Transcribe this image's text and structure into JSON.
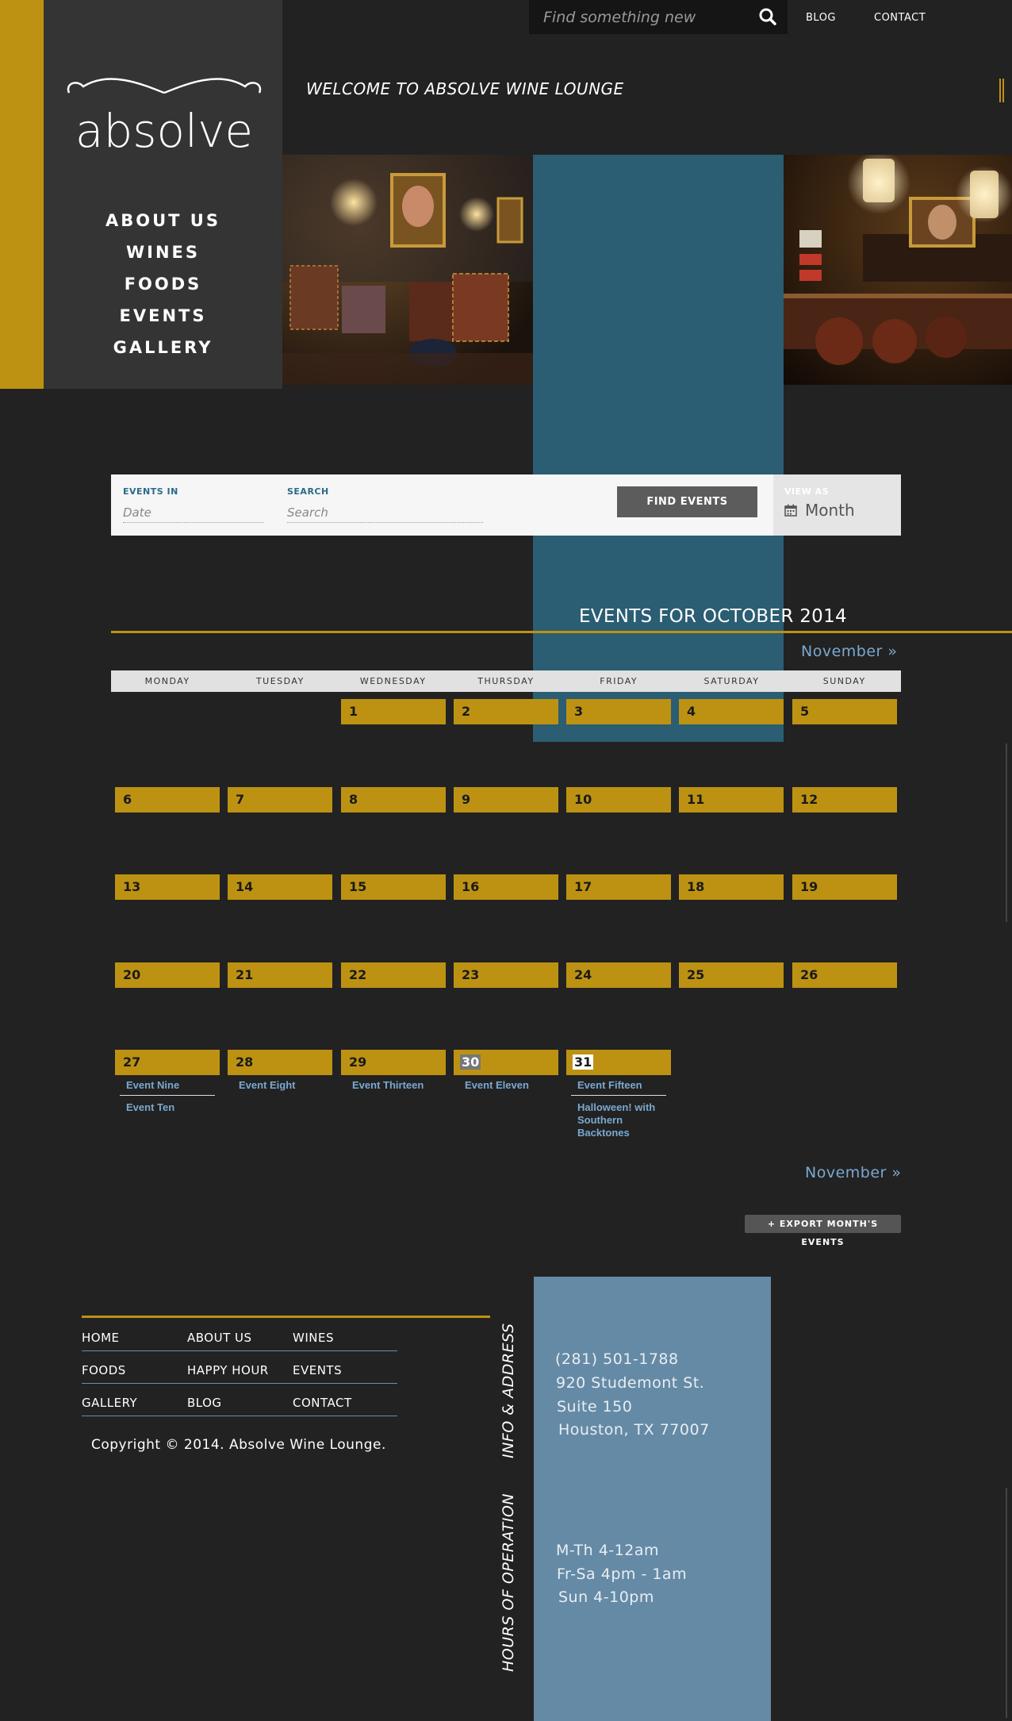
{
  "brand": {
    "logo_text": "absolve",
    "gold": "#bd9212",
    "blue": "#2b5d73",
    "info_blue": "#658aa5"
  },
  "nav_main": [
    "ABOUT US",
    "WINES",
    "FOODS",
    "EVENTS",
    "GALLERY"
  ],
  "topbar": {
    "search_placeholder": "Find something new",
    "search_icon": "search-icon",
    "links": [
      "BLOG",
      "CONTACT"
    ]
  },
  "welcome": "WELCOME TO ABSOLVE WINE LOUNGE",
  "filter": {
    "events_in_label": "EVENTS IN",
    "date_placeholder": "Date",
    "search_label": "SEARCH",
    "search_placeholder": "Search",
    "find_button": "FIND EVENTS",
    "view_as_label": "VIEW AS",
    "view_as_value": "Month",
    "view_icon": "calendar-icon"
  },
  "calendar": {
    "title": "EVENTS FOR OCTOBER 2014",
    "next_label": "November »",
    "weekdays": [
      "MONDAY",
      "TUESDAY",
      "WEDNESDAY",
      "THURSDAY",
      "FRIDAY",
      "SATURDAY",
      "SUNDAY"
    ],
    "first_weekday_index": 2,
    "days_in_month": 31,
    "highlight_white": 31,
    "highlight_grey": 30,
    "events": [
      {
        "day": 27,
        "titles": [
          "Event Nine",
          "Event Ten"
        ]
      },
      {
        "day": 28,
        "titles": [
          "Event Eight"
        ]
      },
      {
        "day": 29,
        "titles": [
          "Event Thirteen"
        ]
      },
      {
        "day": 30,
        "titles": [
          "Event Eleven"
        ]
      },
      {
        "day": 31,
        "titles": [
          "Event Fifteen",
          "Halloween! with Southern Backtones"
        ]
      }
    ],
    "export_label": "+ EXPORT MONTH'S EVENTS"
  },
  "footer": {
    "links": [
      "HOME",
      "ABOUT US",
      "WINES",
      "FOODS",
      "HAPPY HOUR",
      "EVENTS",
      "GALLERY",
      "BLOG",
      "CONTACT"
    ],
    "copyright": "Copyright © 2014. Absolve Wine Lounge.",
    "info_title": "INFO & ADDRESS",
    "hours_title": "HOURS OF OPERATION",
    "phone": "(281) 501-1788",
    "address": [
      "920 Studemont St.",
      "Suite 150",
      "Houston, TX 77007"
    ],
    "hours": [
      "M-Th 4-12am",
      "Fr-Sa 4pm - 1am",
      "Sun 4-10pm"
    ]
  }
}
